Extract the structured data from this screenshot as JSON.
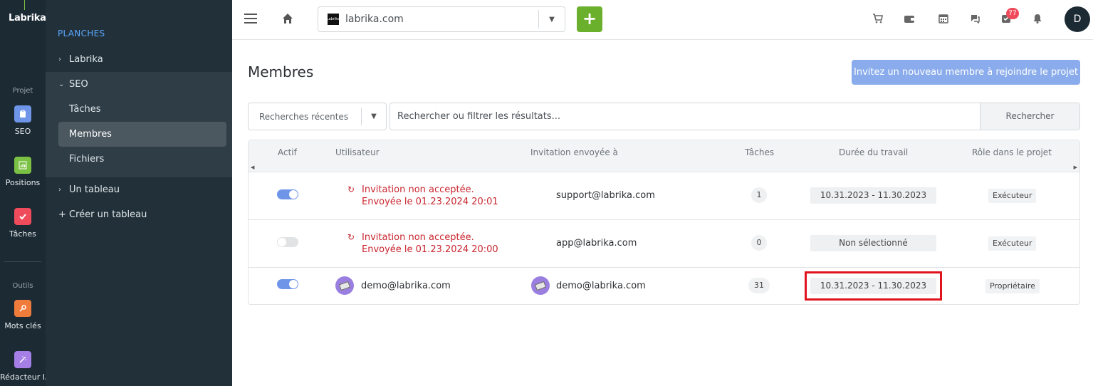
{
  "rail": {
    "logo": "Labrika",
    "section_project": "Projet",
    "section_tools": "Outils",
    "items": [
      {
        "label": "SEO",
        "color": "#6f95e9"
      },
      {
        "label": "Positions",
        "color": "#7bc143"
      },
      {
        "label": "Tâches",
        "color": "#ef4b5b"
      },
      {
        "label": "Mots clés",
        "color": "#f07c3c"
      },
      {
        "label": "Rédacteur IA",
        "color": "#a57ee6"
      }
    ]
  },
  "sidebar": {
    "title": "PLANCHES",
    "boards": [
      {
        "label": "Labrika"
      },
      {
        "label": "SEO"
      },
      {
        "label": "Un tableau"
      }
    ],
    "seo_children": [
      "Tâches",
      "Membres",
      "Fichiers"
    ],
    "create_board": "+ Créer un tableau"
  },
  "topbar": {
    "site": "labrika.com",
    "fav_text": "Labrika",
    "add": "+",
    "notifications_count": "77",
    "user_initial": "D"
  },
  "main": {
    "title": "Membres",
    "invite_button": "Invitez un nouveau membre à rejoindre le projet",
    "recent_searches": "Recherches récentes",
    "search_placeholder": "Rechercher ou filtrer les résultats...",
    "search_button": "Rechercher"
  },
  "table": {
    "headers": [
      "Actif",
      "Utilisateur",
      "Invitation envoyée à",
      "Tâches",
      "Durée du travail",
      "Rôle dans le projet"
    ],
    "rows": [
      {
        "active": true,
        "status_line1": "Invitation non acceptée.",
        "status_line2": "Envoyée le 01.23.2024 20:01",
        "email": "support@labrika.com",
        "tasks": "1",
        "duration": "10.31.2023 - 11.30.2023",
        "role": "Exécuteur"
      },
      {
        "active": false,
        "status_line1": "Invitation non acceptée.",
        "status_line2": "Envoyée le 01.23.2024 20:00",
        "email": "app@labrika.com",
        "tasks": "0",
        "duration": "Non sélectionné",
        "role": "Exécuteur"
      },
      {
        "active": true,
        "user": "demo@labrika.com",
        "email": "demo@labrika.com",
        "tasks": "31",
        "duration": "10.31.2023 - 11.30.2023",
        "role": "Propriétaire"
      }
    ]
  }
}
